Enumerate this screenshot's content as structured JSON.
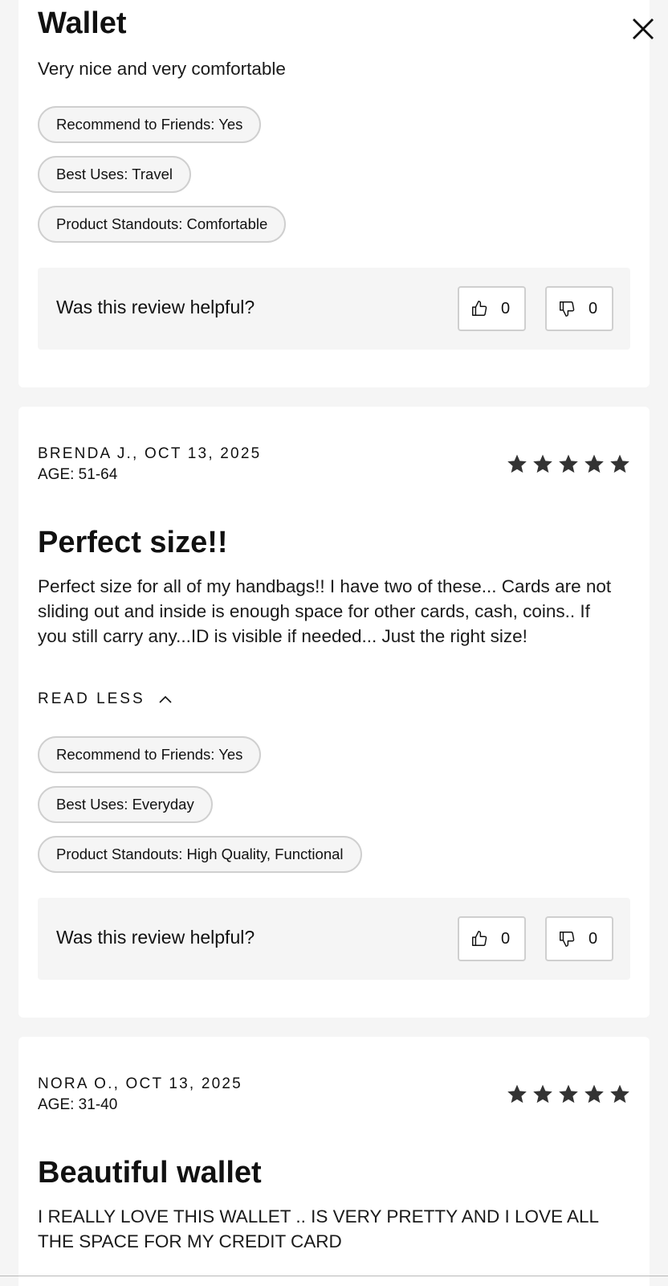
{
  "reviews": [
    {
      "title": "Wallet",
      "body": "Very nice and very comfortable",
      "tags": [
        "Recommend to Friends: Yes",
        "Best Uses: Travel",
        "Product Standouts: Comfortable"
      ],
      "helpful": {
        "question": "Was this review helpful?",
        "up_count": "0",
        "down_count": "0"
      }
    },
    {
      "author": "BRENDA J., OCT 13, 2025",
      "age": "AGE: 51-64",
      "rating": 5,
      "title": "Perfect size!!",
      "body": "Perfect size for all of my handbags!! I have two of these... Cards are not sliding out and inside is enough space for other cards, cash, coins.. If you still carry any...ID is visible if needed... Just the right size!",
      "read_less": "READ LESS",
      "tags": [
        "Recommend to Friends: Yes",
        "Best Uses: Everyday",
        "Product Standouts: High Quality, Functional"
      ],
      "helpful": {
        "question": "Was this review helpful?",
        "up_count": "0",
        "down_count": "0"
      }
    },
    {
      "author": "NORA O., OCT 13, 2025",
      "age": "AGE: 31-40",
      "rating": 5,
      "title": "Beautiful wallet",
      "body": "I REALLY LOVE THIS WALLET .. IS VERY PRETTY AND I LOVE ALL THE SPACE FOR MY CREDIT CARD"
    }
  ],
  "icons": {
    "close": "close-icon",
    "thumbs_up": "thumbs-up-icon",
    "thumbs_down": "thumbs-down-icon",
    "star": "star-icon",
    "chevron_up": "chevron-up-icon"
  },
  "colors": {
    "page_background": "#f5f5f5",
    "card_background": "#ffffff",
    "text": "#111111",
    "star": "#333333",
    "pill_border": "#cfcfcf"
  }
}
